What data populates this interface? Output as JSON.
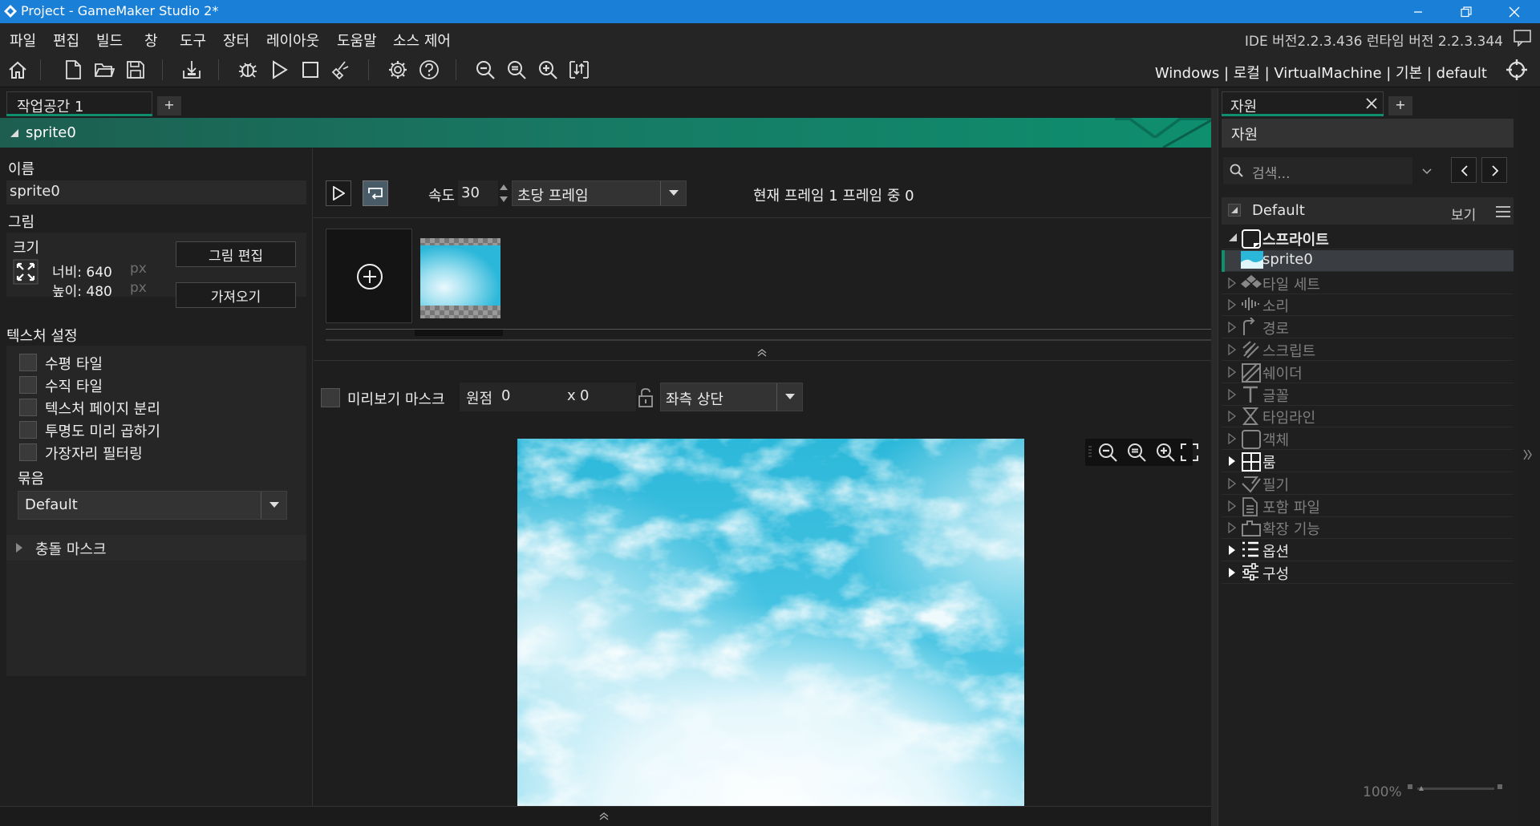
{
  "titlebar": {
    "title": "Project - GameMaker Studio 2*"
  },
  "menubar": {
    "items": [
      "파일",
      "편집",
      "빌드",
      "창",
      "도구",
      "장터",
      "레이아웃",
      "도움말",
      "소스 제어"
    ],
    "version": "IDE 버전2.2.3.436 런타임 버전 2.2.3.344"
  },
  "toolbar": {
    "targets": "Windows | 로컬 | VirtualMachine | 기본 | default"
  },
  "workspace": {
    "tab_label": "작업공간 1",
    "add_label": "+"
  },
  "sprite_editor": {
    "header": "sprite0",
    "name_label": "이름",
    "name_value": "sprite0",
    "image_label": "그림",
    "size_label": "크기",
    "width_label": "너비: 640",
    "height_label": "높이: 480",
    "px": "px",
    "edit_image_button": "그림 편집",
    "import_button": "가져오기",
    "texture_settings_label": "텍스처 설정",
    "checkboxes": [
      "수평 타일",
      "수직 타일",
      "텍스처 페이지 분리",
      "투명도 미리 곱하기",
      "가장자리 필터링"
    ],
    "group_label": "묶음",
    "group_value": "Default",
    "collision_mask_label": "충돌 마스크",
    "speed_label": "속도",
    "speed_value": "30",
    "speed_unit": "초당 프레임",
    "frame_info": "현재 프레임 1 프레임 중 0",
    "preview_mask_label": "미리보기 마스크",
    "origin_label": "원점",
    "origin_x": "0",
    "origin_y_label": "x",
    "origin_y": "0",
    "origin_preset": "좌측 상단"
  },
  "resources": {
    "tab_label": "자원",
    "add_label": "+",
    "header": "자원",
    "search_placeholder": "검색...",
    "group_name": "Default",
    "view_label": "보기",
    "zoom_label": "100%",
    "tree": [
      {
        "label": "스프라이트",
        "icon": "sprite-icon",
        "expanded": true,
        "bold": true
      },
      {
        "label": "sprite0",
        "icon": "sprite-thumb-icon",
        "child": true,
        "selected": true
      },
      {
        "label": "타일 세트",
        "icon": "tileset-icon",
        "dim": true
      },
      {
        "label": "소리",
        "icon": "sound-icon",
        "dim": true
      },
      {
        "label": "경로",
        "icon": "path-icon",
        "dim": true
      },
      {
        "label": "스크립트",
        "icon": "script-icon",
        "dim": true
      },
      {
        "label": "쉐이더",
        "icon": "shader-icon",
        "dim": true
      },
      {
        "label": "글꼴",
        "icon": "font-icon",
        "dim": true
      },
      {
        "label": "타임라인",
        "icon": "timeline-icon",
        "dim": true
      },
      {
        "label": "객체",
        "icon": "object-icon",
        "dim": true
      },
      {
        "label": "룸",
        "icon": "room-icon",
        "filled": true
      },
      {
        "label": "필기",
        "icon": "note-icon",
        "dim": true
      },
      {
        "label": "포함 파일",
        "icon": "included-file-icon",
        "dim": true
      },
      {
        "label": "확장 기능",
        "icon": "extension-icon",
        "dim": true
      },
      {
        "label": "옵션",
        "icon": "options-icon",
        "filled": true
      },
      {
        "label": "구성",
        "icon": "configurations-icon",
        "filled": true
      }
    ]
  },
  "colors": {
    "titlebar": "#1a7fd6",
    "accent_green": "#0e8f6e",
    "selected_row": "#3a3d41",
    "sky": "#2bb7d9"
  }
}
